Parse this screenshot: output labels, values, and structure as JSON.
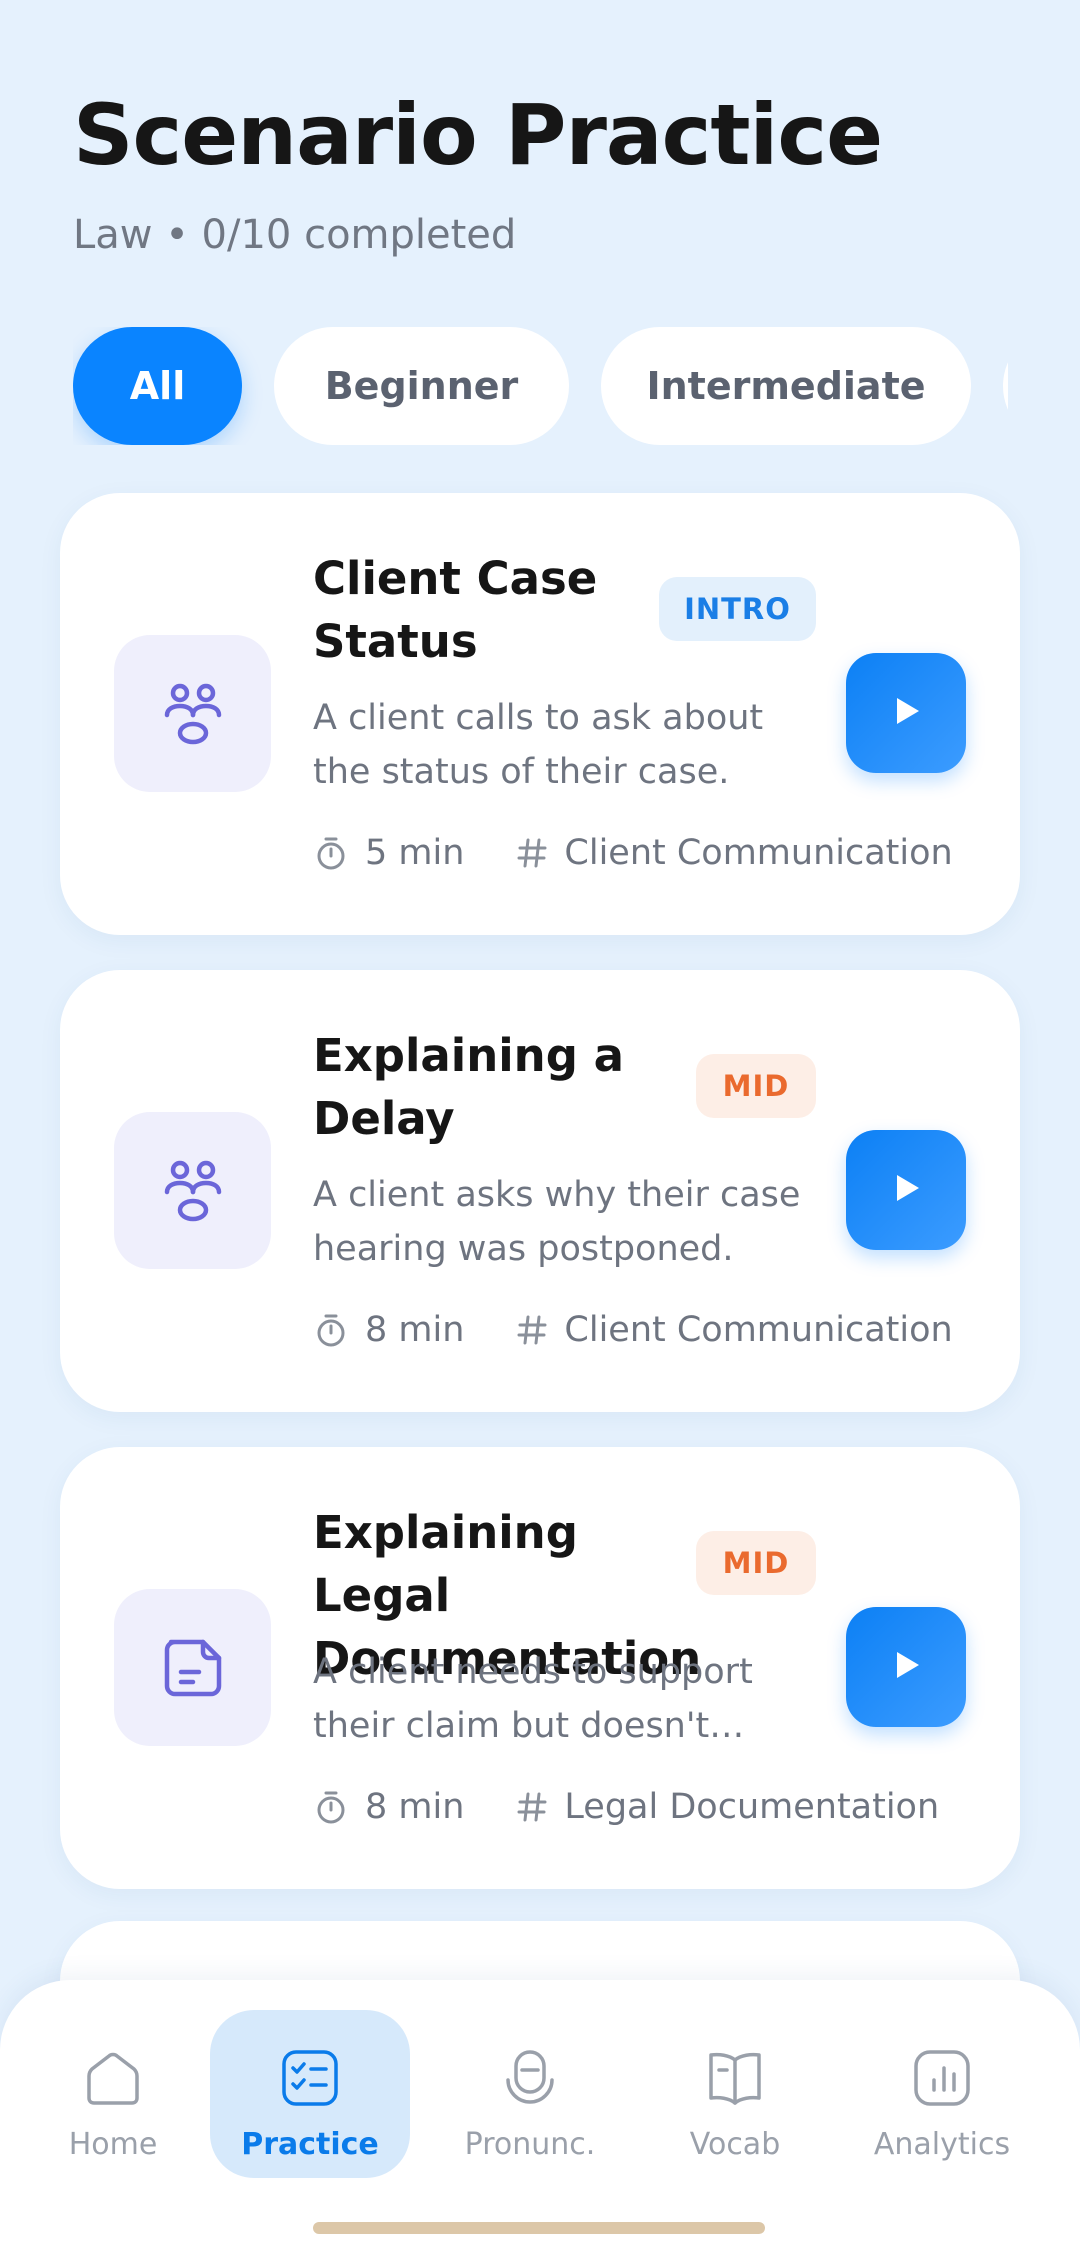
{
  "header": {
    "title": "Scenario Practice",
    "subtitle": "Law • 0/10 completed"
  },
  "filters": [
    {
      "label": "All",
      "active": true
    },
    {
      "label": "Beginner",
      "active": false
    },
    {
      "label": "Intermediate",
      "active": false
    },
    {
      "label": "",
      "active": false
    }
  ],
  "scenarios": [
    {
      "title": "Client Case Status",
      "level": "INTRO",
      "description": "A client calls to ask about the status of their case.",
      "duration": "5 min",
      "category": "Client Communication",
      "icon": "people-icon"
    },
    {
      "title": "Explaining a Delay",
      "level": "MID",
      "description": "A client asks why their case hearing was postponed.",
      "duration": "8 min",
      "category": "Client Communication",
      "icon": "people-icon"
    },
    {
      "title": "Explaining Legal Documentation",
      "level": "MID",
      "description": "A client needs to support their claim but doesn't understand what documentation is required.",
      "duration": "8 min",
      "category": "Legal Documentation",
      "icon": "document-icon"
    }
  ],
  "nav": {
    "items": [
      {
        "label": "Home",
        "icon": "home-icon"
      },
      {
        "label": "Practice",
        "icon": "checklist-icon",
        "active": true
      },
      {
        "label": "Pronunc.",
        "icon": "microphone-icon"
      },
      {
        "label": "Vocab",
        "icon": "book-icon"
      },
      {
        "label": "Analytics",
        "icon": "analytics-icon"
      }
    ]
  },
  "colors": {
    "background": "#E5F1FD",
    "accent": "#0A84FF",
    "intro_badge": "#1A7EE6",
    "mid_badge": "#EA6A2E",
    "icon_purple": "#6B66D9"
  }
}
